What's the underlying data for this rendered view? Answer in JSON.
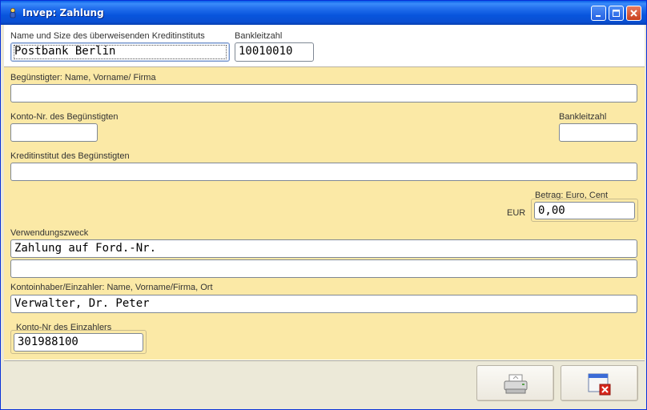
{
  "window": {
    "title": "Invep: Zahlung"
  },
  "bank": {
    "name_label": "Name und Size des überweisenden Kreditinstituts",
    "name_value": "Postbank Berlin",
    "blz_label": "Bankleitzahl",
    "blz_value": "10010010"
  },
  "beneficiary": {
    "name_label": "Begünstigter: Name, Vorname/ Firma",
    "name_value": "",
    "account_label": "Konto-Nr. des Begünstigten",
    "account_value": "",
    "blz_label": "Bankleitzahl",
    "blz_value": "",
    "institute_label": "Kreditinstitut des Begünstigten",
    "institute_value": ""
  },
  "amount": {
    "label": "Betrag: Euro, Cent",
    "currency": "EUR",
    "value": "0,00"
  },
  "purpose": {
    "label": "Verwendungszweck",
    "line1": "Zahlung auf Ford.-Nr.",
    "line2": ""
  },
  "payer": {
    "name_label": "Kontoinhaber/Einzahler: Name, Vorname/Firma, Ort",
    "name_value": "Verwalter, Dr. Peter",
    "account_label": "Konto-Nr des Einzahlers",
    "account_value": "301988100"
  },
  "icons": {
    "print": "printer-icon",
    "close": "window-close-icon",
    "app": "app-icon"
  },
  "colors": {
    "form_background": "#FBE9A6",
    "titlebar": "#0A55DD",
    "close_accent": "#D8261B"
  }
}
